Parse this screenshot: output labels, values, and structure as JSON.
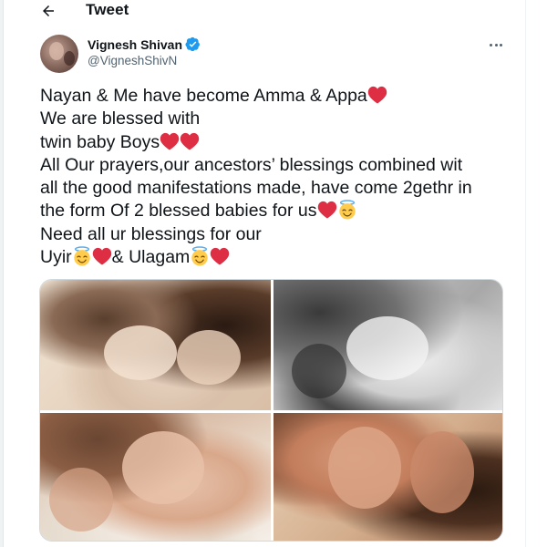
{
  "header": {
    "title": "Tweet",
    "back_icon": "arrow-left-icon"
  },
  "tweet": {
    "author": {
      "display_name": "Vignesh Shivan",
      "handle": "@VigneshShivN",
      "verified": true
    },
    "text_lines": [
      {
        "text": "Nayan & Me have become Amma & Appa",
        "suffix_emojis": [
          "red-heart"
        ]
      },
      {
        "text": "We are blessed with",
        "suffix_emojis": []
      },
      {
        "text": "twin baby Boys",
        "suffix_emojis": [
          "red-heart",
          "red-heart"
        ]
      },
      {
        "text": "All Our prayers,our ancestors’ blessings combined wit",
        "suffix_emojis": []
      },
      {
        "text": "all the good manifestations made, have come 2gethr in",
        "suffix_emojis": []
      },
      {
        "text": "the form Of 2 blessed babies for us",
        "suffix_emojis": [
          "red-heart",
          "smiling-face-with-halo"
        ]
      },
      {
        "text": "Need all ur blessings for our",
        "suffix_emojis": []
      },
      {
        "text": "Uyir",
        "suffix_emojis": [
          "smiling-face-with-halo",
          "red-heart"
        ],
        "after": "& Ulagam",
        "after_emojis": [
          "smiling-face-with-halo",
          "red-heart"
        ]
      }
    ],
    "media_count": 4
  },
  "colors": {
    "text_primary": "#0f1419",
    "text_secondary": "#536471",
    "verified_blue": "#1d9bf0",
    "heart_red": "#dd2e44",
    "border": "#cfd9de"
  }
}
